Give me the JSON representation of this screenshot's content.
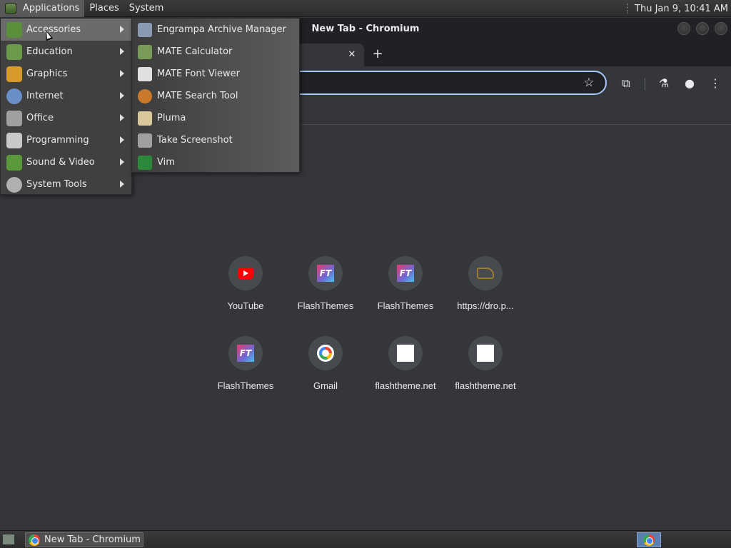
{
  "top_panel": {
    "menus": [
      "Applications",
      "Places",
      "System"
    ],
    "clock": "Thu Jan  9, 10:41 AM"
  },
  "window": {
    "title": "New Tab - Chromium",
    "tab_close": "✕",
    "new_tab": "+"
  },
  "toolbar": {
    "star": "☆",
    "extensions": "⧉",
    "labs": "⚗",
    "profile": "●",
    "menu": "⋮"
  },
  "shortcuts": [
    {
      "label": "YouTube",
      "icon": "youtube-icon"
    },
    {
      "label": "FlashThemes",
      "icon": "flashthemes-icon"
    },
    {
      "label": "FlashThemes",
      "icon": "flashthemes-icon"
    },
    {
      "label": "https://dro.p...",
      "icon": "shoe-icon"
    },
    {
      "label": "FlashThemes",
      "icon": "flashthemes-icon"
    },
    {
      "label": "Gmail",
      "icon": "google-icon"
    },
    {
      "label": "flashtheme.net",
      "icon": "blank-page-icon"
    },
    {
      "label": "flashtheme.net",
      "icon": "blank-page-icon"
    }
  ],
  "apps_menu": {
    "items": [
      {
        "label": "Accessories",
        "color": "#5c8f3c"
      },
      {
        "label": "Education",
        "color": "#6a9a4a"
      },
      {
        "label": "Graphics",
        "color": "#d89a2a"
      },
      {
        "label": "Internet",
        "color": "#6a8fc8"
      },
      {
        "label": "Office",
        "color": "#a0a0a0"
      },
      {
        "label": "Programming",
        "color": "#c8c8c8"
      },
      {
        "label": "Sound & Video",
        "color": "#5a9a3a"
      },
      {
        "label": "System Tools",
        "color": "#b0b0b0"
      }
    ],
    "active_index": 0
  },
  "accessories_menu": {
    "items": [
      {
        "label": "Engrampa Archive Manager",
        "color": "#8a9ab0"
      },
      {
        "label": "MATE Calculator",
        "color": "#7a9a5a"
      },
      {
        "label": "MATE Font Viewer",
        "color": "#e0e0e0"
      },
      {
        "label": "MATE Search Tool",
        "color": "#c87a2a"
      },
      {
        "label": "Pluma",
        "color": "#d8c89a"
      },
      {
        "label": "Take Screenshot",
        "color": "#a0a0a0"
      },
      {
        "label": "Vim",
        "color": "#2a8a3a"
      }
    ]
  },
  "taskbar": {
    "task_label": "New Tab - Chromium"
  }
}
